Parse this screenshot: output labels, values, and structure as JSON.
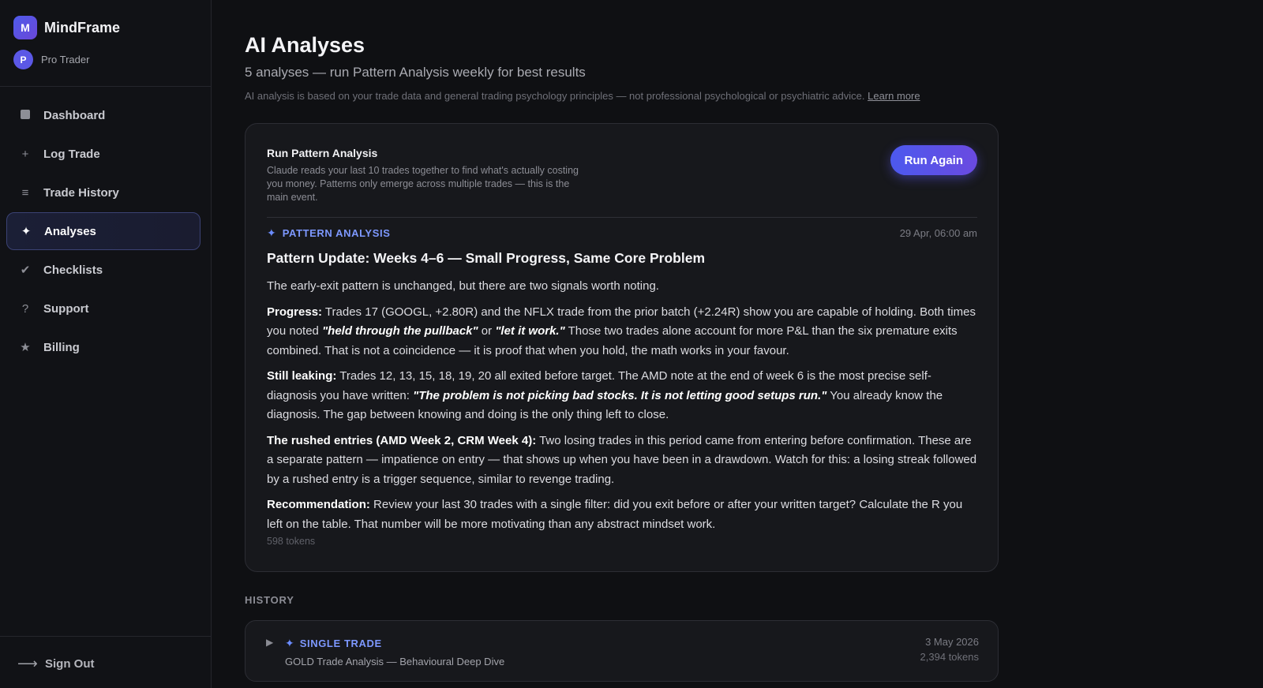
{
  "app": {
    "logo_letter": "M",
    "name": "MindFrame",
    "user_initial": "P",
    "user_plan": "Pro Trader"
  },
  "nav": {
    "items": [
      {
        "label": "Dashboard",
        "icon": "square-icon"
      },
      {
        "label": "Log Trade",
        "icon": "plus-icon"
      },
      {
        "label": "Trade History",
        "icon": "list-icon"
      },
      {
        "label": "Analyses",
        "icon": "sparkle-icon",
        "active": true
      },
      {
        "label": "Checklists",
        "icon": "check-icon"
      },
      {
        "label": "Support",
        "icon": "question-icon"
      },
      {
        "label": "Billing",
        "icon": "star-icon"
      }
    ],
    "sign_out": "Sign Out"
  },
  "page": {
    "title": "AI Analyses",
    "subtitle": "5 analyses — run Pattern Analysis weekly for best results",
    "disclaimer": "AI analysis is based on your trade data and general trading psychology principles — not professional psychological or psychiatric advice.",
    "learn_more": "Learn more"
  },
  "run_card": {
    "title": "Run Pattern Analysis",
    "description": "Claude reads your last 10 trades together to find what's actually costing you money. Patterns only emerge across multiple trades — this is the main event.",
    "button": "Run Again"
  },
  "analysis": {
    "tag": "PATTERN ANALYSIS",
    "date": "29 Apr, 06:00 am",
    "heading": "Pattern Update: Weeks 4–6 — Small Progress, Same Core Problem",
    "intro": "The early-exit pattern is unchanged, but there are two signals worth noting.",
    "progress": {
      "label": "Progress:",
      "text1": " Trades 17 (GOOGL, +2.80R) and the NFLX trade from the prior batch (+2.24R) show you are capable of holding. Both times you noted ",
      "quote1": "\"held through the pullback\"",
      "text2": " or ",
      "quote2": "\"let it work.\"",
      "text3": " Those two trades alone account for more P&L than the six premature exits combined. That is not a coincidence — it is proof that when you hold, the math works in your favour."
    },
    "leaking": {
      "label": "Still leaking:",
      "text1": " Trades 12, 13, 15, 18, 19, 20 all exited before target. The AMD note at the end of week 6 is the most precise self-diagnosis you have written: ",
      "quote": "\"The problem is not picking bad stocks. It is not letting good setups run.\"",
      "text2": " You already know the diagnosis. The gap between knowing and doing is the only thing left to close."
    },
    "rushed": {
      "label": "The rushed entries (AMD Week 2, CRM Week 4):",
      "text": " Two losing trades in this period came from entering before confirmation. These are a separate pattern — impatience on entry — that shows up when you have been in a drawdown. Watch for this: a losing streak followed by a rushed entry is a trigger sequence, similar to revenge trading."
    },
    "recommendation": {
      "label": "Recommendation:",
      "text": " Review your last 30 trades with a single filter: did you exit before or after your written target? Calculate the R you left on the table. That number will be more motivating than any abstract mindset work."
    },
    "tokens": "598 tokens"
  },
  "history": {
    "label": "HISTORY",
    "items": [
      {
        "tag": "SINGLE TRADE",
        "title": "GOLD Trade Analysis — Behavioural Deep Dive",
        "date": "3 May 2026",
        "tokens": "2,394 tokens"
      }
    ]
  },
  "colors": {
    "accent": "#5b58e6",
    "tag_blue": "#7d98ff",
    "background": "#0f1013",
    "card": "#17181c"
  }
}
